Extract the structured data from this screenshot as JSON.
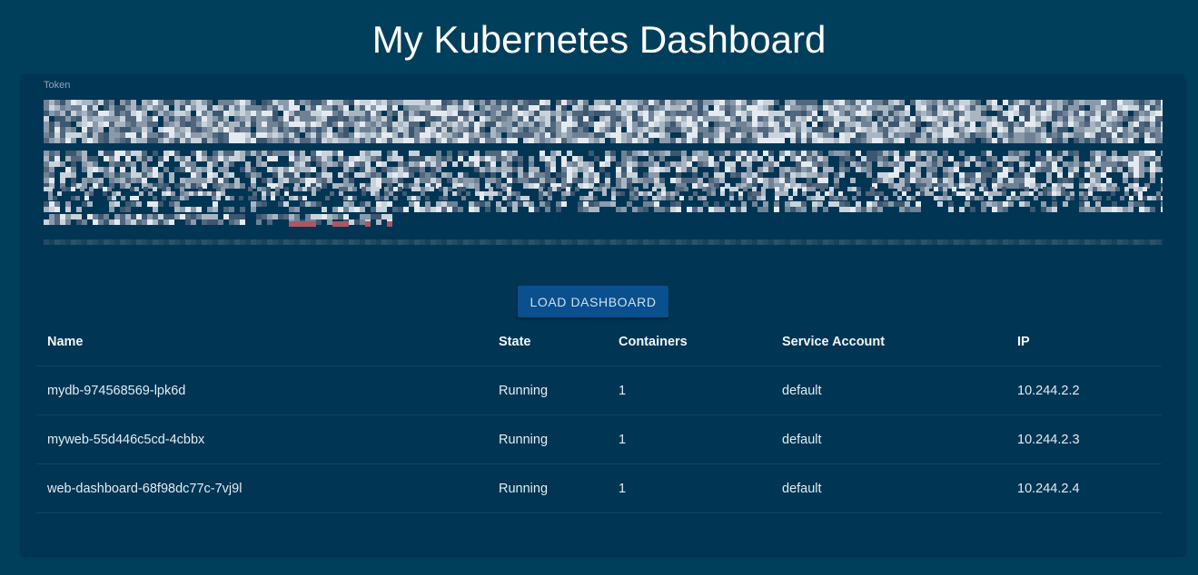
{
  "header": {
    "title": "My Kubernetes Dashboard"
  },
  "token": {
    "label": "Token",
    "value_state": "redacted (pixelated)"
  },
  "actions": {
    "load_label": "LOAD DASHBOARD"
  },
  "table": {
    "columns": [
      "Name",
      "State",
      "Containers",
      "Service Account",
      "IP"
    ],
    "rows": [
      {
        "name": "mydb-974568569-lpk6d",
        "state": "Running",
        "containers": "1",
        "service_account": "default",
        "ip": "10.244.2.2"
      },
      {
        "name": "myweb-55d446c5cd-4cbbx",
        "state": "Running",
        "containers": "1",
        "service_account": "default",
        "ip": "10.244.2.3"
      },
      {
        "name": "web-dashboard-68f98dc77c-7vj9l",
        "state": "Running",
        "containers": "1",
        "service_account": "default",
        "ip": "10.244.2.4"
      }
    ]
  },
  "colors": {
    "background": "#003f5c",
    "card": "#003553",
    "button": "#0a4f8e",
    "row_divider": "#0f4764"
  }
}
